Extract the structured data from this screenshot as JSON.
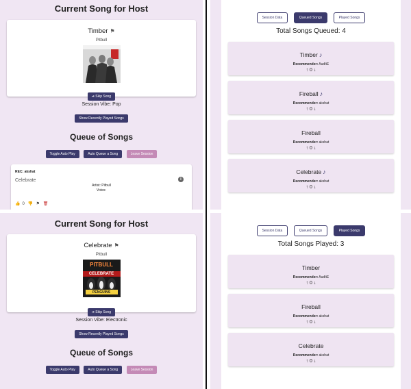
{
  "panel_top_left": {
    "host_title": "Current Song for Host",
    "song": {
      "name": "Timber",
      "artist": "Pitbull",
      "flag_icon": "flag-icon"
    },
    "skip_label": "⏯ Skip Song",
    "session_vibe": "Session Vibe: Pop",
    "recent_label": "Show Recently Played Songs",
    "queue_title": "Queue of Songs",
    "queue_buttons": {
      "toggle": "Toggle Auto Play",
      "auto": "Auto Queue a Song",
      "leave": "Leave Session"
    },
    "queue_item": {
      "rec": "REC: akshat",
      "song": "Celebrate",
      "artist": "Artist: Pitbull",
      "votes": "Votes:",
      "up_count": "0"
    }
  },
  "panel_bottom_left": {
    "host_title": "Current Song for Host",
    "song": {
      "name": "Celebrate",
      "artist": "Pitbull"
    },
    "art_text": {
      "line1": "PITBULL",
      "line2": "CELEBRATE",
      "line3": "PENGUINS"
    },
    "skip_label": "⏯ Skip Song",
    "session_vibe": "Session Vibe: Electronic",
    "recent_label": "Show Recently Played Songs",
    "queue_title": "Queue of Songs",
    "queue_buttons": {
      "toggle": "Toggle Auto Play",
      "auto": "Auto Queue a Song",
      "leave": "Leave Session"
    }
  },
  "panel_top_right": {
    "tabs": [
      "Session Data",
      "Queued Songs",
      "Played Songs"
    ],
    "active_tab": 1,
    "total": "Total Songs Queued: 4",
    "songs": [
      {
        "name": "Timber",
        "recommender_label": "Recommender:",
        "recommender": "AudItE",
        "votes": "↑ 0 ↓"
      },
      {
        "name": "Fireball",
        "recommender_label": "Recommender:",
        "recommender": "akshat",
        "votes": "↑ 0 ↓"
      },
      {
        "name": "Fireball",
        "recommender_label": "Recommender:",
        "recommender": "akshat",
        "votes": "↑ 0 ↓"
      },
      {
        "name": "Celebrate",
        "recommender_label": "Recommender:",
        "recommender": "akshat",
        "votes": "↑ 0 ↓"
      }
    ]
  },
  "panel_bottom_right": {
    "tabs": [
      "Session Data",
      "Queued Songs",
      "Played Songs"
    ],
    "active_tab": 2,
    "total": "Total Songs Played: 3",
    "songs": [
      {
        "name": "Timber",
        "recommender_label": "Recommender:",
        "recommender": "AudItE",
        "votes": "↑ 0 ↓"
      },
      {
        "name": "Fireball",
        "recommender_label": "Recommender:",
        "recommender": "akshat",
        "votes": "↑ 0 ↓"
      },
      {
        "name": "Celebrate",
        "recommender_label": "Recommender:",
        "recommender": "akshat",
        "votes": "↑ 0 ↓"
      }
    ]
  },
  "colors": {
    "panel_bg": "#f0e6f3",
    "primary": "#3b3a6c",
    "pink": "#c48ab6",
    "delete": "#c62828"
  }
}
